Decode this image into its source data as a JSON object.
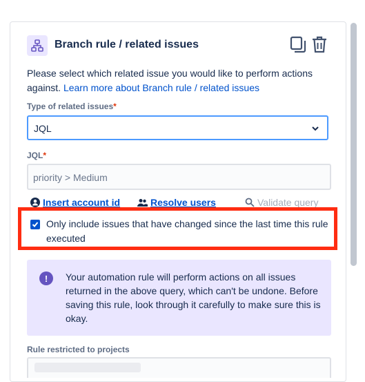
{
  "header": {
    "title": "Branch rule / related issues",
    "component_icon": "branch-hierarchy-icon",
    "duplicate_icon": "copy-icon",
    "delete_icon": "trash-icon"
  },
  "description": {
    "text": "Please select which related issue you would like to perform actions against.",
    "link": "Learn more about Branch rule / related issues"
  },
  "type_field": {
    "label": "Type of related issues",
    "required_mark": "*",
    "value": "JQL"
  },
  "jql_field": {
    "label": "JQL",
    "required_mark": "*",
    "value": "priority > Medium"
  },
  "actions": {
    "insert_account_id": "Insert account id",
    "resolve_users": "Resolve users",
    "validate_query": "Validate query"
  },
  "checkbox": {
    "checked": true,
    "label": "Only include issues that have changed since the last time this rule executed"
  },
  "info": {
    "text": "Your automation rule will perform actions on all issues returned in the above query, which can't be undone. Before saving this rule, look through it carefully to make sure this is okay."
  },
  "restricted": {
    "label": "Rule restricted to projects"
  },
  "colors": {
    "accent": "#0052cc",
    "highlight": "#ff2d12",
    "info_bg": "#eae6ff",
    "info_icon": "#6554c0"
  }
}
